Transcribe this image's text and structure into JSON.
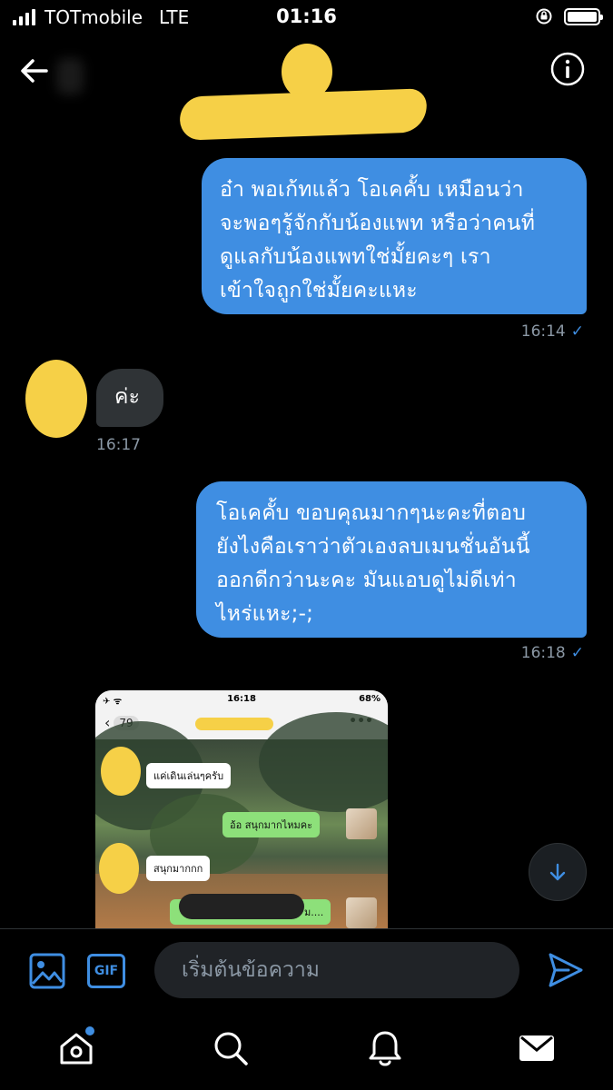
{
  "status_bar": {
    "carrier": "TOTmobile",
    "network": "LTE",
    "time": "01:16"
  },
  "messages": [
    {
      "id": "m1",
      "direction": "sent",
      "lines": [
        "อ๋า พอเก้ทแล้ว โอเคคั้บ เหมือนว่า",
        "จะพอๆรู้จักกับน้องแพท หรือว่าคนที่",
        "ดูแลกับน้องแพทใช่มั้ยคะๆ เรา",
        "เข้าใจถูกใช่มั้ยคะแหะ"
      ],
      "time": "16:14"
    },
    {
      "id": "m2",
      "direction": "received",
      "text": "ค่ะ",
      "time": "16:17"
    },
    {
      "id": "m3",
      "direction": "sent",
      "lines": [
        "โอเคคั้บ ขอบคุณมากๆนะคะที่ตอบ",
        "ยังไงคือเราว่าตัวเองลบเมนชั่นอันนี้",
        "ออกดีกว่านะคะ มันแอบดูไม่ดีเท่า",
        "ไหร่แหะ;-;"
      ],
      "time": "16:18"
    }
  ],
  "shared_image": {
    "status_time": "16:18",
    "battery": "68%",
    "back_badge": "79",
    "bubbles": [
      "แค่เดินเล่นๆครับ",
      "อ้อ สนุกมากไหมคะ",
      "สนุกมากกก",
      "ม...."
    ]
  },
  "composer": {
    "gif_label": "GIF",
    "placeholder": "เริ่มต้นข้อความ"
  },
  "colors": {
    "accent": "#3f8ee2",
    "sent_bubble": "#3f8ee2",
    "received_bubble": "#2f3336",
    "timestamp": "#8b98a5",
    "redaction": "#f6d047"
  },
  "icons": {
    "back": "arrow-left-icon",
    "info": "info-icon",
    "scroll": "arrow-down-icon",
    "image": "image-icon",
    "send": "send-icon",
    "tabs": [
      "home-icon",
      "search-icon",
      "bell-icon",
      "mail-icon"
    ]
  }
}
